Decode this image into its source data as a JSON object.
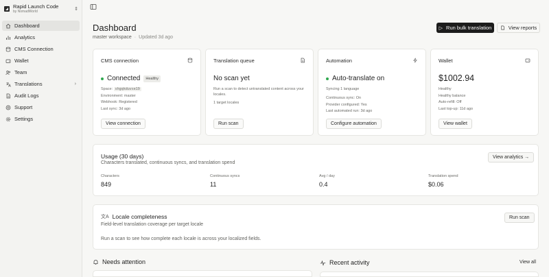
{
  "workspace": {
    "name": "Rapid Launch Code",
    "by": "by NomadWorld"
  },
  "sidebar": {
    "items": [
      {
        "label": "Dashboard",
        "icon": "home-icon",
        "active": true
      },
      {
        "label": "Analytics",
        "icon": "analytics-icon"
      },
      {
        "label": "CMS Connection",
        "icon": "database-icon"
      },
      {
        "label": "Wallet",
        "icon": "wallet-icon"
      },
      {
        "label": "Team",
        "icon": "team-icon"
      },
      {
        "label": "Translations",
        "icon": "languages-icon",
        "expandable": true
      },
      {
        "label": "Audit Logs",
        "icon": "document-icon"
      },
      {
        "label": "Support",
        "icon": "support-icon"
      },
      {
        "label": "Settings",
        "icon": "gear-icon"
      }
    ]
  },
  "header": {
    "title": "Dashboard",
    "workspace": "master workspace",
    "updated": "Updated 3d ago",
    "run_button": "Run bulk translation",
    "reports_button": "View reports"
  },
  "cards": {
    "cms": {
      "title": "CMS connection",
      "status": "Connected",
      "badge": "Healthy",
      "space_label": "Space:",
      "space_id": "shgqkduvse19",
      "environment": "Environment: master",
      "webhook": "Webhook: Registered",
      "last_sync": "Last sync: 3d ago",
      "button": "View connection"
    },
    "queue": {
      "title": "Translation queue",
      "status": "No scan yet",
      "desc": "Run a scan to detect untranslated content across your locales.",
      "locales": "1 target locales",
      "button": "Run scan"
    },
    "automation": {
      "title": "Automation",
      "status": "Auto-translate on",
      "syncing": "Syncing 1 language",
      "continuous": "Continuous sync: On",
      "provider": "Provider configured: Yes",
      "last_run": "Last automated run: 3d ago",
      "button": "Configure automation"
    },
    "wallet": {
      "title": "Wallet",
      "balance": "$1002.94",
      "health": "Healthy",
      "health_balance": "Healthy balance",
      "refill": "Auto-refill: Off",
      "topup": "Last top-up: 11d ago",
      "button": "View wallet"
    }
  },
  "usage": {
    "title": "Usage (30 days)",
    "subtitle": "Characters translated, continuous syncs, and translation spend",
    "button": "View analytics →",
    "metrics": [
      {
        "label": "Characters",
        "value": "849"
      },
      {
        "label": "Continuous syncs",
        "value": "11"
      },
      {
        "label": "Avg / day",
        "value": "0.4"
      },
      {
        "label": "Translation spend",
        "value": "$0.06"
      }
    ]
  },
  "locale": {
    "title": "Locale completeness",
    "subtitle": "Field-level translation coverage per target locale",
    "message": "Run a scan to see how complete each locale is across your localized fields.",
    "button": "Run scan"
  },
  "attention": {
    "title": "Needs attention"
  },
  "activity": {
    "title": "Recent activity",
    "view_all": "View all"
  },
  "colors": {
    "accent": "#1c1c1c",
    "status_green": "#2fa84f"
  }
}
